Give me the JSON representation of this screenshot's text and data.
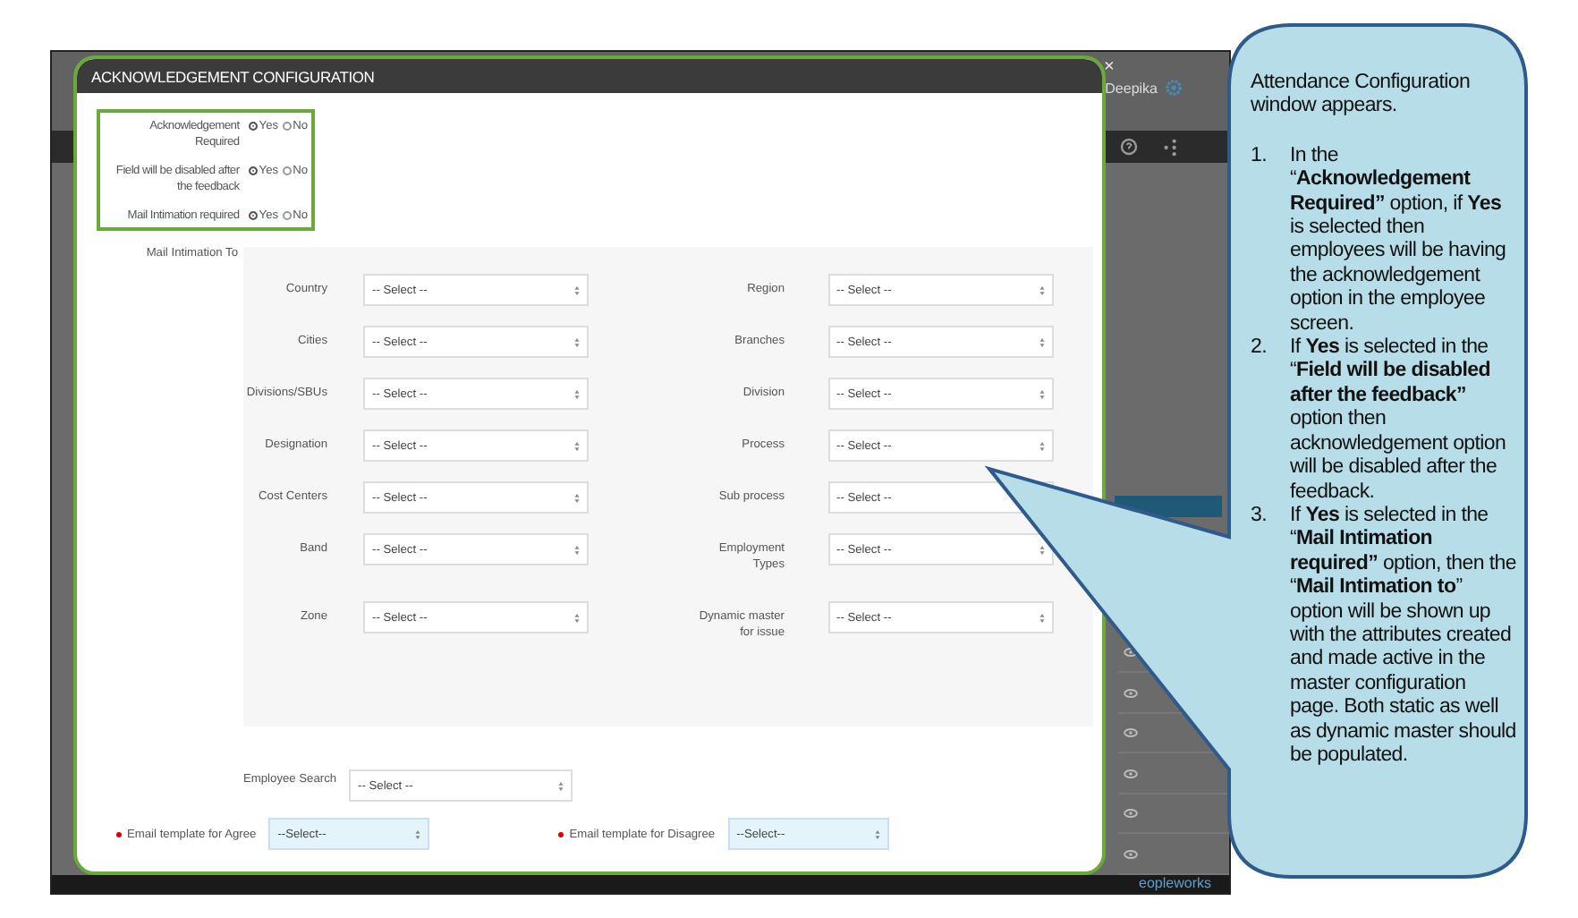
{
  "background_app": {
    "user_name": "Deepika",
    "footer_brand": "eopleworks"
  },
  "modal": {
    "title": "ACKNOWLEDGEMENT CONFIGURATION",
    "close": "×",
    "options": [
      {
        "label": "Acknowledgement Required",
        "choices": [
          {
            "label": "Yes",
            "selected": true
          },
          {
            "label": "No",
            "selected": false
          }
        ]
      },
      {
        "label": "Field will be disabled after the feedback",
        "choices": [
          {
            "label": "Yes",
            "selected": true
          },
          {
            "label": "No",
            "selected": false
          }
        ]
      },
      {
        "label": "Mail Intimation required",
        "choices": [
          {
            "label": "Yes",
            "selected": true
          },
          {
            "label": "No",
            "selected": false
          }
        ]
      }
    ],
    "mail_intimation": {
      "label": "Mail Intimation To",
      "fields": [
        {
          "label": "Country",
          "value": "-- Select --"
        },
        {
          "label": "Region",
          "value": "-- Select --"
        },
        {
          "label": "Cities",
          "value": "-- Select --"
        },
        {
          "label": "Branches",
          "value": "-- Select --"
        },
        {
          "label": "Divisions/SBUs",
          "value": "-- Select --"
        },
        {
          "label": "Division",
          "value": "-- Select --"
        },
        {
          "label": "Designation",
          "value": "-- Select --"
        },
        {
          "label": "Process",
          "value": "-- Select --"
        },
        {
          "label": "Cost Centers",
          "value": "-- Select --"
        },
        {
          "label": "Sub process",
          "value": "-- Select --"
        },
        {
          "label": "Band",
          "value": "-- Select --"
        },
        {
          "label": "Employment Types",
          "value": "-- Select --"
        },
        {
          "label": "Zone",
          "value": "-- Select --"
        },
        {
          "label": "Dynamic master for issue",
          "value": "-- Select --"
        }
      ]
    },
    "employee_search": {
      "label": "Employee Search",
      "value": "-- Select --"
    },
    "email_templates": [
      {
        "label": "Email template for Agree",
        "value": "--Select--",
        "required": true
      },
      {
        "label": "Email template for Disagree",
        "value": "--Select--",
        "required": true
      }
    ]
  },
  "callout": {
    "intro": "Attendance Configuration window appears.",
    "steps": [
      {
        "number": "1.",
        "text": "In the “**Acknowledgement Required”** option, if **Yes** is selected then employees will be having the acknowledgement option in the employee screen."
      },
      {
        "number": "2.",
        "text": "If **Yes** is selected in the “**Field will be disabled after the feedback”** option then acknowledgement option will be disabled after the feedback."
      },
      {
        "number": "3.",
        "text": "If **Yes** is selected in the “**Mail Intimation required”** option, then the “**Mail Intimation to**” option will be shown up with the attributes created and made active in the master configuration page. Both static as well as dynamic master should be populated."
      }
    ]
  }
}
